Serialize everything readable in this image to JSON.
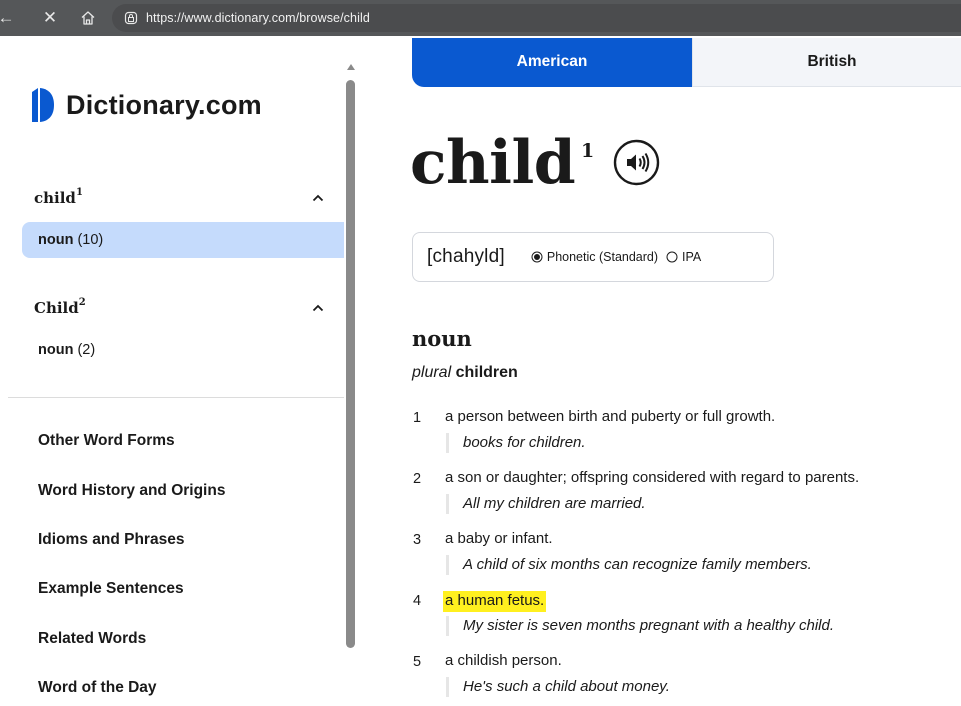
{
  "browser": {
    "url": "https://www.dictionary.com/browse/child",
    "back_glyph": "←",
    "close_glyph": "✕"
  },
  "sidebar": {
    "logo_text": "Dictionary.com",
    "entries": [
      {
        "word": "child",
        "sup": "1",
        "pos": "noun",
        "count": "(10)",
        "active": true
      },
      {
        "word": "Child",
        "sup": "2",
        "pos": "noun",
        "count": "(2)",
        "active": false
      }
    ],
    "sections": [
      "Other Word Forms",
      "Word History and Origins",
      "Idioms and Phrases",
      "Example Sentences",
      "Related Words",
      "Word of the Day"
    ]
  },
  "main": {
    "toggle": {
      "american": "American",
      "british": "British",
      "selected": "American"
    },
    "headword": "child",
    "headword_sup": "1",
    "pronunciation": {
      "text": "[chahyld]",
      "options": [
        "Phonetic (Standard)",
        "IPA"
      ],
      "selected": "Phonetic (Standard)"
    },
    "pos_heading": "noun",
    "plural_label": "plural",
    "plural_form": "children",
    "definitions": [
      {
        "num": "1",
        "text": "a person between birth and puberty or full growth.",
        "example": "books for children."
      },
      {
        "num": "2",
        "text": "a son or daughter; offspring considered with regard to parents.",
        "example": "All my children are married."
      },
      {
        "num": "3",
        "text": "a baby or infant.",
        "example": "A child of six months can recognize family members."
      },
      {
        "num": "4",
        "text": "a human fetus.",
        "example": "My sister is seven months pregnant with a healthy child.",
        "highlighted": true
      },
      {
        "num": "5",
        "text": "a childish person.",
        "example": "He's such a child about money."
      }
    ]
  },
  "colors": {
    "brand_blue": "#0a59d0",
    "active_item_bg": "#c5dbfc",
    "highlight": "#fff01f"
  }
}
